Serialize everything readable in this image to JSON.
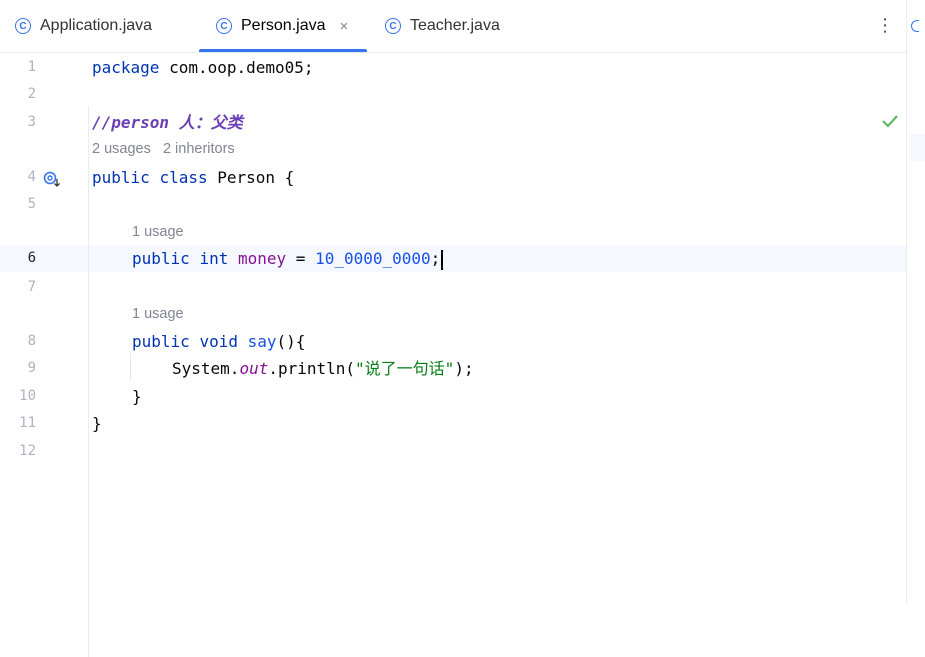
{
  "tabs": [
    {
      "label": "Application.java",
      "icon": "class-icon",
      "active": false
    },
    {
      "label": "Person.java",
      "icon": "class-icon",
      "active": true
    },
    {
      "label": "Teacher.java",
      "icon": "class-icon",
      "active": false
    }
  ],
  "tab_icon_letter": "C",
  "close_glyph": "×",
  "menu_glyph": "⋮",
  "line_numbers": [
    "1",
    "2",
    "3",
    "4",
    "5",
    "6",
    "7",
    "8",
    "9",
    "10",
    "11",
    "12"
  ],
  "current_line": "6",
  "hints": {
    "class_usages": "2 usages",
    "class_inheritors": "2 inheritors",
    "field_usage": "1 usage",
    "method_usage": "1 usage"
  },
  "code": {
    "l1_kw": "package",
    "l1_rest": " com.oop.demo05;",
    "l3_comment": "//person 人：父类",
    "l4_kw1": "public",
    "l4_kw2": "class",
    "l4_rest": " Person {",
    "l6_kw1": "public",
    "l6_kw2": "int",
    "l6_field": "money",
    "l6_eq": " = ",
    "l6_num": "10_0000_0000",
    "l6_semi": ";",
    "l8_kw1": "public",
    "l8_kw2": "void",
    "l8_method": "say",
    "l8_rest": "(){",
    "l9_obj": "System.",
    "l9_static": "out",
    "l9_call": ".println(",
    "l9_str": "\"说了一句话\"",
    "l9_end": ");",
    "l10": "}",
    "l11": "}"
  },
  "colors": {
    "accent": "#3574f0",
    "keyword": "#0033b3",
    "field": "#871094",
    "number": "#1750eb",
    "string": "#067d17",
    "check": "#5fb865"
  }
}
